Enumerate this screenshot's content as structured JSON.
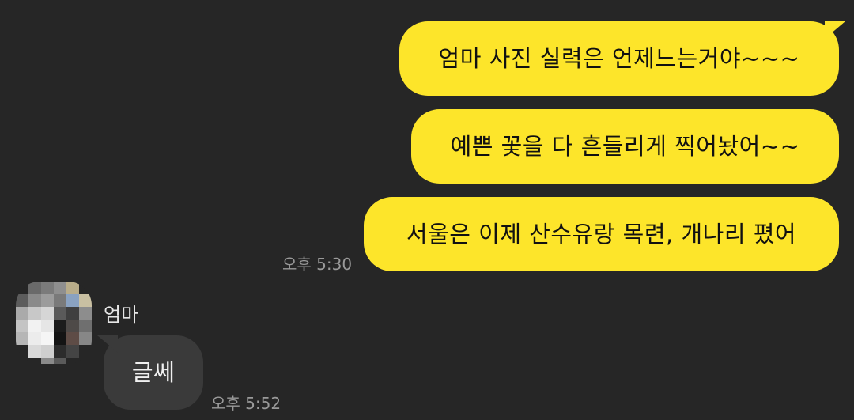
{
  "messages": {
    "outgoing": [
      "엄마 사진 실력은 언제느는거야~~~",
      "예쁜 꽃을 다 흔들리게 찍어놨어~~",
      "서울은 이제 산수유랑 목련, 개나리 폈어"
    ],
    "outgoing_time": "오후 5:30",
    "incoming": {
      "sender": "엄마",
      "text": "글쎄",
      "time": "오후 5:52"
    }
  },
  "colors": {
    "background": "#262626",
    "outgoing_bubble": "#fde52a",
    "incoming_bubble": "#3a3a3a",
    "timestamp": "#9a9a9a"
  },
  "icons": {
    "avatar": "pixelated-profile-photo"
  }
}
